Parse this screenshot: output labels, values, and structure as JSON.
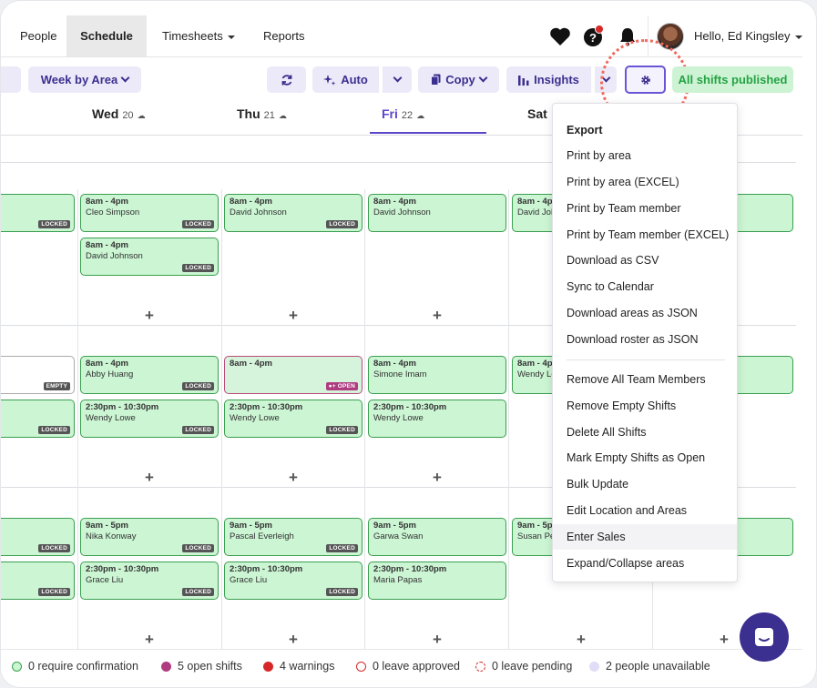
{
  "nav": {
    "people": "People",
    "schedule": "Schedule",
    "timesheets": "Timesheets",
    "reports": "Reports",
    "greeting": "Hello, Ed Kingsley"
  },
  "toolbar": {
    "view": "Week by Area",
    "auto": "Auto",
    "copy": "Copy",
    "insights": "Insights",
    "published": "All shifts published"
  },
  "days": [
    {
      "name": "Wed",
      "num": "20"
    },
    {
      "name": "Thu",
      "num": "21"
    },
    {
      "name": "Fri",
      "num": "22"
    },
    {
      "name": "Sat",
      "num": ""
    }
  ],
  "shifts": {
    "wed_1a": {
      "time": "8am - 4pm",
      "name": "Cleo Simpson",
      "badge": "LOCKED"
    },
    "wed_1b": {
      "time": "8am - 4pm",
      "name": "David Johnson",
      "badge": "LOCKED"
    },
    "thu_1a": {
      "time": "8am - 4pm",
      "name": "David Johnson",
      "badge": "LOCKED"
    },
    "fri_1a": {
      "time": "8am - 4pm",
      "name": "David Johnson"
    },
    "sat_1a": {
      "time": "8am - 4p",
      "name": "David Joh"
    },
    "wed_2a": {
      "time": "8am - 4pm",
      "name": "Abby Huang",
      "badge": "LOCKED"
    },
    "wed_2b": {
      "time": "2:30pm - 10:30pm",
      "name": "Wendy Lowe",
      "badge": "LOCKED"
    },
    "thu_2a": {
      "time": "8am - 4pm",
      "badge": "OPEN"
    },
    "thu_2b": {
      "time": "2:30pm - 10:30pm",
      "name": "Wendy Lowe",
      "badge": "LOCKED"
    },
    "fri_2a": {
      "time": "8am - 4pm",
      "name": "Simone Imam"
    },
    "fri_2b": {
      "time": "2:30pm - 10:30pm",
      "name": "Wendy Lowe"
    },
    "sat_2a": {
      "time": "8am - 4p",
      "name": "Wendy Lo"
    },
    "wed_3a": {
      "time": "9am - 5pm",
      "name": "Nika Konway",
      "badge": "LOCKED"
    },
    "wed_3b": {
      "time": "2:30pm - 10:30pm",
      "name": "Grace Liu",
      "badge": "LOCKED"
    },
    "thu_3a": {
      "time": "9am - 5pm",
      "name": "Pascal Everleigh",
      "badge": "LOCKED"
    },
    "thu_3b": {
      "time": "2:30pm - 10:30pm",
      "name": "Grace Liu",
      "badge": "LOCKED"
    },
    "fri_3a": {
      "time": "9am - 5pm",
      "name": "Garwa Swan"
    },
    "fri_3b": {
      "time": "2:30pm - 10:30pm",
      "name": "Maria Papas"
    },
    "sat_3a": {
      "time": "9am - 5p",
      "name": "Susan Pe"
    },
    "edge_1a": {
      "badge": "LOCKED"
    },
    "edge_2a": {
      "badge": "EMPTY"
    },
    "edge_2b": {
      "badge": "LOCKED"
    },
    "edge_3a": {
      "badge": "LOCKED"
    },
    "edge_3b": {
      "badge": "LOCKED"
    }
  },
  "menu": {
    "title": "Export",
    "export_items": [
      "Print by area",
      "Print by area (EXCEL)",
      "Print by Team member",
      "Print by Team member (EXCEL)",
      "Download as CSV",
      "Sync to Calendar",
      "Download areas as JSON",
      "Download roster as JSON"
    ],
    "action_items": [
      "Remove All Team Members",
      "Remove Empty Shifts",
      "Delete All Shifts",
      "Mark Empty Shifts as Open",
      "Bulk Update",
      "Edit Location and Areas",
      "Enter Sales",
      "Expand/Collapse areas"
    ]
  },
  "footer": {
    "confirm": "0 require confirmation",
    "open": "5 open shifts",
    "warnings": "4 warnings",
    "leave_approved": "0 leave approved",
    "leave_pending": "0 leave pending",
    "unavailable": "2 people unavailable"
  },
  "colors": {
    "accent": "#5b47c9",
    "shift_bg": "#cbf5d3",
    "shift_border": "#3a9f4f",
    "open_dot": "#b03c80",
    "warning_dot": "#d62828"
  }
}
